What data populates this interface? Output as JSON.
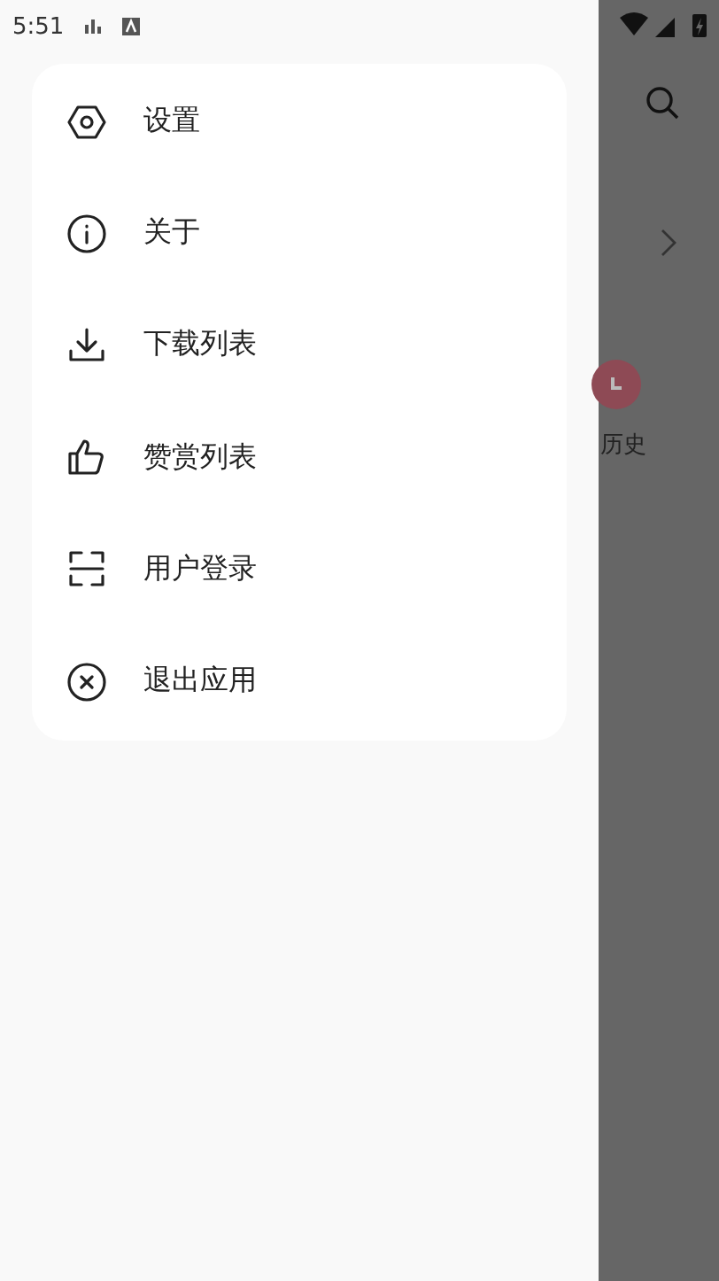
{
  "status_bar": {
    "time": "5:51"
  },
  "drawer": {
    "items": [
      {
        "label": "设置"
      },
      {
        "label": "关于"
      },
      {
        "label": "下载列表"
      },
      {
        "label": "赞赏列表"
      },
      {
        "label": "用户登录"
      },
      {
        "label": "退出应用"
      }
    ]
  },
  "background_page": {
    "shortcut_label": "历史"
  }
}
